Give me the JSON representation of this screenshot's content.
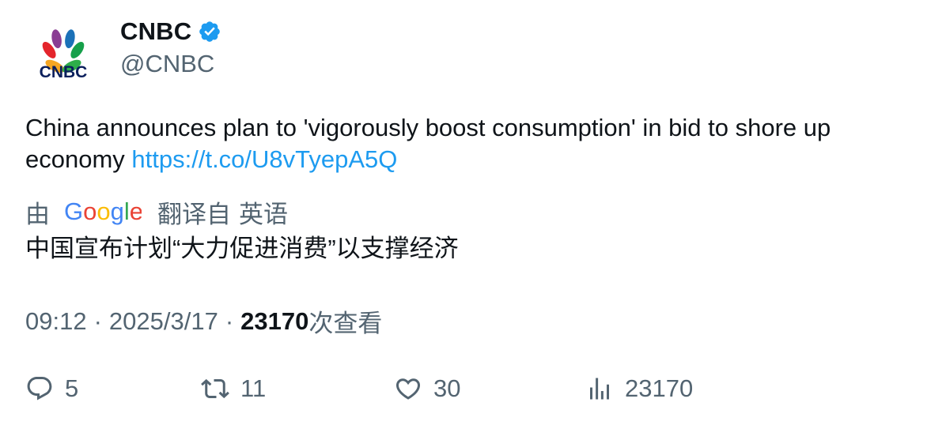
{
  "author": {
    "display_name": "CNBC",
    "handle": "@CNBC",
    "avatar_icon": "cnbc-peacock-logo",
    "logo_text": "CNBC",
    "verified_icon": "verified-badge-icon",
    "verified_color": "#1d9bf0"
  },
  "tweet": {
    "text": "China announces plan to 'vigorously boost consumption' in bid to shore up economy ",
    "link": "https://t.co/U8vTyepA5Q",
    "link_color": "#1d9bf0"
  },
  "translation": {
    "prefix": "由",
    "provider": "Google",
    "suffix": "翻译自",
    "source_language": "英语",
    "translated_text": "中国宣布计划“大力促进消费”以支撑经济"
  },
  "meta": {
    "time": "09:12",
    "date": "2025/3/17",
    "views_count": "23170",
    "views_label": "次查看"
  },
  "actions": {
    "reply": {
      "icon": "reply-icon",
      "count": "5"
    },
    "retweet": {
      "icon": "retweet-icon",
      "count": "11"
    },
    "like": {
      "icon": "heart-icon",
      "count": "30"
    },
    "views": {
      "icon": "analytics-icon",
      "count": "23170"
    }
  },
  "colors": {
    "text_primary": "#0f1419",
    "text_secondary": "#536471",
    "accent": "#1d9bf0"
  }
}
